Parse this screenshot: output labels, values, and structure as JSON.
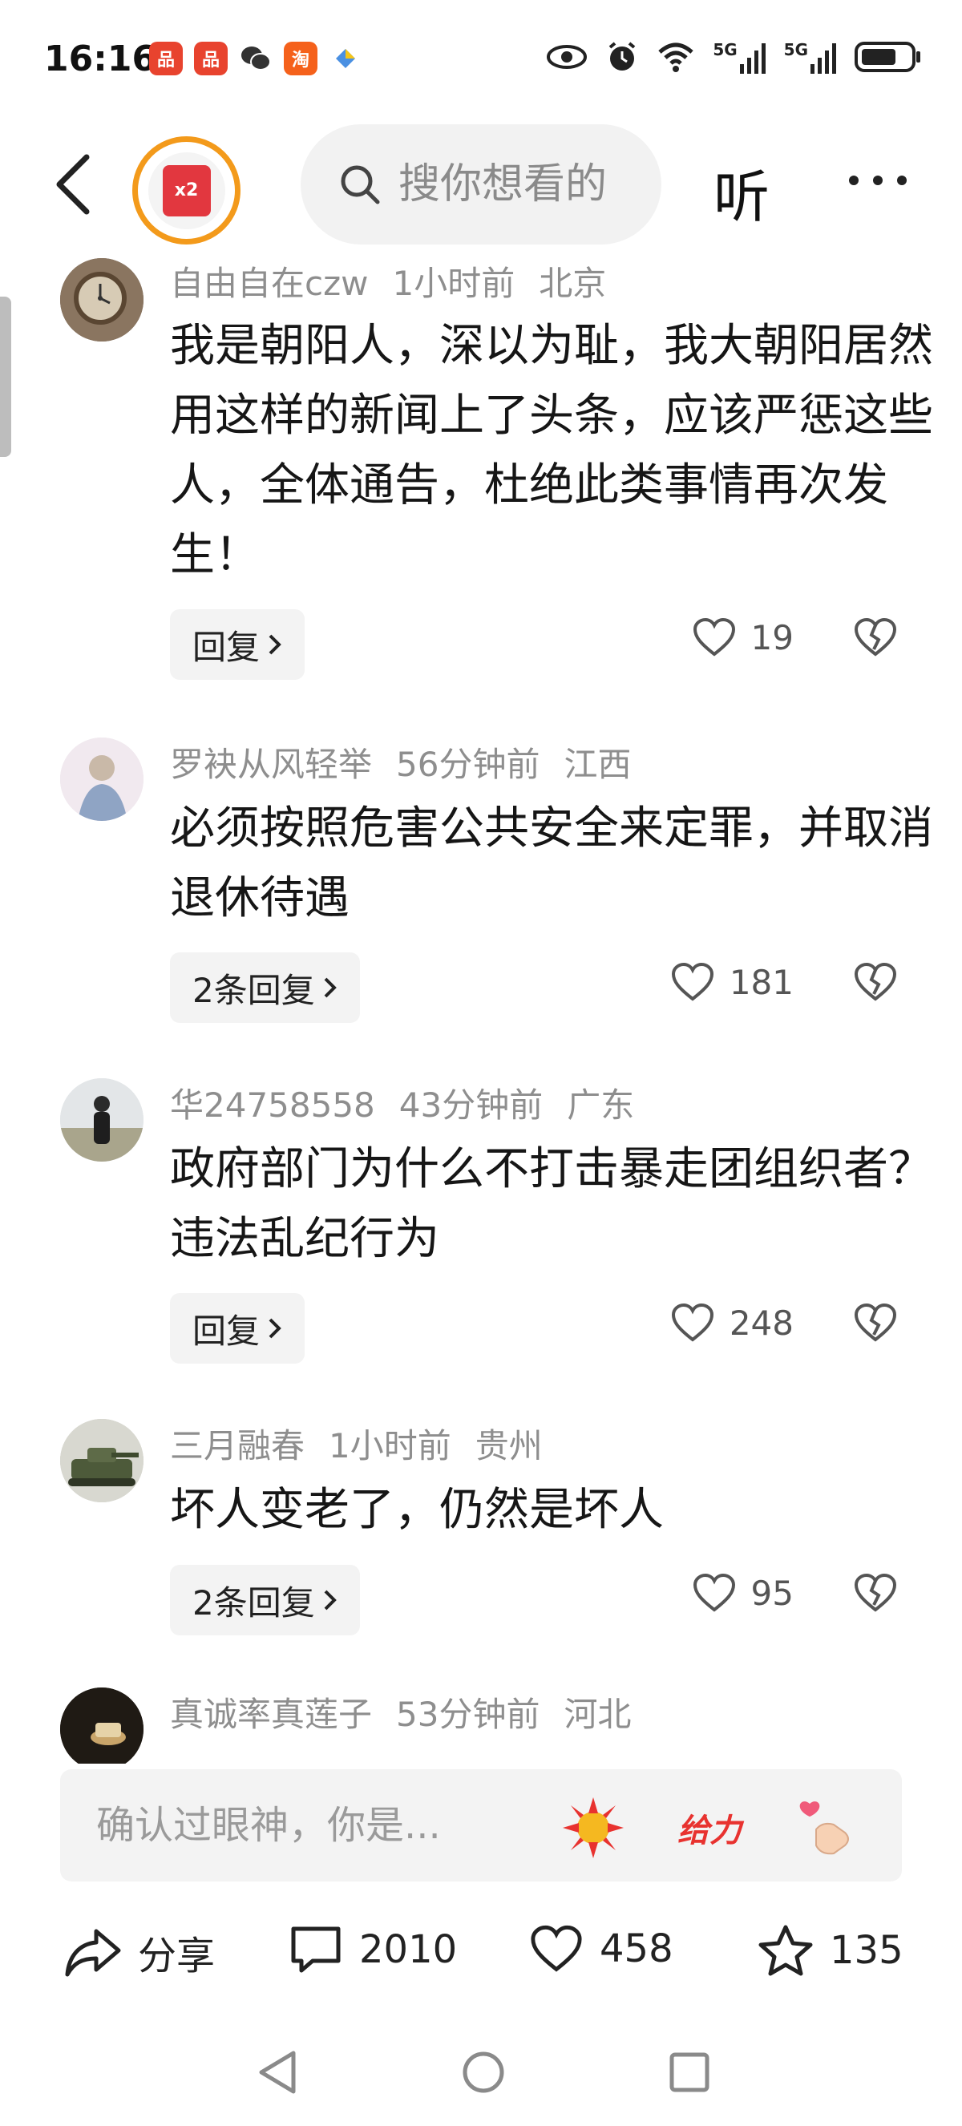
{
  "status_bar": {
    "time": "16:16",
    "apps": [
      {
        "icon": "pinduoduo-icon",
        "glyph": "品",
        "color": "#e8432e"
      },
      {
        "icon": "pinduoduo-icon-2",
        "glyph": "品",
        "color": "#e8432e"
      },
      {
        "icon": "wechat-icon",
        "glyph": "✉",
        "color": "#333333"
      },
      {
        "icon": "taobao-icon",
        "glyph": "淘",
        "color": "#f5611b"
      },
      {
        "icon": "app-icon",
        "glyph": "●",
        "color": "#4a90e2"
      }
    ],
    "network_1": "5G",
    "network_2": "5G"
  },
  "nav": {
    "badge_text": "x2",
    "search_placeholder": "搜你想看的",
    "listen_label": "听"
  },
  "comments": [
    {
      "username": "自由自在czw",
      "time": "1小时前",
      "location": "北京",
      "text": "我是朝阳人，深以为耻，我大朝阳居然用这样的新闻上了头条，应该严惩这些人，全体通告，杜绝此类事情再次发生！",
      "reply_label": "回复",
      "likes": "19"
    },
    {
      "username": "罗袂从风轻举",
      "time": "56分钟前",
      "location": "江西",
      "text": "必须按照危害公共安全来定罪，并取消退休待遇",
      "reply_label": "2条回复",
      "likes": "181"
    },
    {
      "username": "华24758558",
      "time": "43分钟前",
      "location": "广东",
      "text": "政府部门为什么不打击暴走团组织者？违法乱纪行为",
      "reply_label": "回复",
      "likes": "248"
    },
    {
      "username": "三月融春",
      "time": "1小时前",
      "location": "贵州",
      "text": "坏人变老了，仍然是坏人",
      "reply_label": "2条回复",
      "likes": "95"
    },
    {
      "username": "真诚率真莲子",
      "time": "53分钟前",
      "location": "河北"
    }
  ],
  "comment_input": {
    "placeholder": "确认过眼神，你是...",
    "sticker_2_text": "给力"
  },
  "action_bar": {
    "share_label": "分享",
    "comment_count": "2010",
    "like_count": "458",
    "favorite_count": "135"
  },
  "colors": {
    "accent_orange": "#f39a1b",
    "red_packet": "#e2373f",
    "meta_gray": "#8e8e8e"
  }
}
